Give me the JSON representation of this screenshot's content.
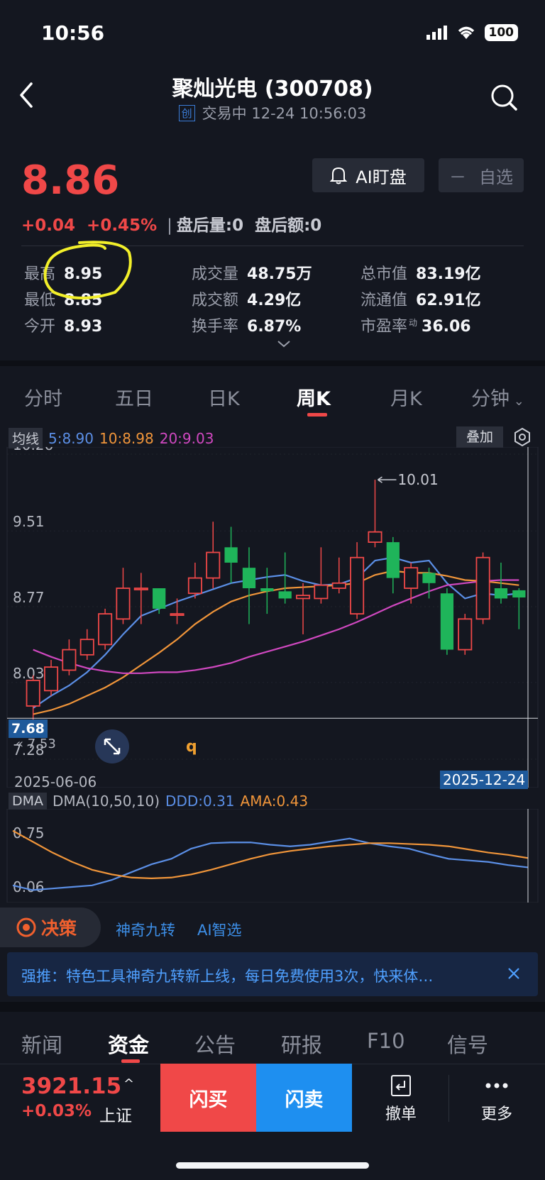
{
  "status_bar": {
    "time": "10:56",
    "battery": "100"
  },
  "header": {
    "title": "聚灿光电 (300708)",
    "board_tag": "创",
    "trade_status": "交易中",
    "timestamp": "12-24 10:56:03"
  },
  "quote": {
    "price": "8.86",
    "change": "+0.04",
    "change_pct": "+0.45%",
    "after_hours_volume": "盘后量:0",
    "after_hours_amount": "盘后额:0",
    "ai_button": "AI盯盘",
    "watch_button": "自选",
    "stats": [
      {
        "label": "最高",
        "value": "8.95",
        "color": "red"
      },
      {
        "label": "成交量",
        "value": "48.75万",
        "color": "white"
      },
      {
        "label": "总市值",
        "value": "83.19亿",
        "color": "white"
      },
      {
        "label": "最低",
        "value": "8.85",
        "color": "green"
      },
      {
        "label": "成交额",
        "value": "4.29亿",
        "color": "white"
      },
      {
        "label": "流通值",
        "value": "62.91亿",
        "color": "white"
      },
      {
        "label": "今开",
        "value": "8.93",
        "color": "red"
      },
      {
        "label": "换手率",
        "value": "6.87%",
        "color": "white"
      },
      {
        "label": "市盈率",
        "value": "36.06",
        "color": "white",
        "sup": "动"
      }
    ]
  },
  "period_tabs": [
    "分时",
    "五日",
    "日K",
    "周K",
    "月K",
    "分钟"
  ],
  "active_period": "周K",
  "ma_legend": {
    "label": "均线",
    "ma5": "5:8.90",
    "ma10": "10:8.98",
    "ma20": "20:9.03",
    "overlay_button": "叠加"
  },
  "chart_labels": {
    "max_marker": "10.01",
    "current_price": "7.68",
    "low_marker": "7.53",
    "q_mark": "q",
    "date_start": "2025-06-06",
    "date_end": "2025-12-24"
  },
  "dma_legend": {
    "label": "DMA",
    "params": "DMA(10,50,10)",
    "ddd": "DDD:0.31",
    "ama": "AMA:0.43"
  },
  "chart_data": [
    {
      "type": "candlestick",
      "title": "",
      "y_ticks": [
        "10.26",
        "9.51",
        "8.77",
        "8.03",
        "7.28"
      ],
      "ylim": [
        7.28,
        10.26
      ],
      "x_range": [
        "2025-06-06",
        "2025-12-24"
      ],
      "candles": [
        {
          "o": 7.8,
          "c": 8.05,
          "h": 8.1,
          "l": 7.53
        },
        {
          "o": 7.95,
          "c": 8.18,
          "h": 8.25,
          "l": 7.9
        },
        {
          "o": 8.15,
          "c": 8.35,
          "h": 8.45,
          "l": 8.1
        },
        {
          "o": 8.3,
          "c": 8.45,
          "h": 8.55,
          "l": 8.25
        },
        {
          "o": 8.4,
          "c": 8.7,
          "h": 8.75,
          "l": 8.35
        },
        {
          "o": 8.65,
          "c": 8.95,
          "h": 9.15,
          "l": 8.6
        },
        {
          "o": 8.95,
          "c": 8.95,
          "h": 9.1,
          "l": 8.6
        },
        {
          "o": 8.95,
          "c": 8.75,
          "h": 8.95,
          "l": 8.7
        },
        {
          "o": 8.7,
          "c": 8.7,
          "h": 8.85,
          "l": 8.6
        },
        {
          "o": 8.9,
          "c": 9.05,
          "h": 9.2,
          "l": 8.85
        },
        {
          "o": 9.05,
          "c": 9.3,
          "h": 9.6,
          "l": 8.95
        },
        {
          "o": 9.35,
          "c": 9.2,
          "h": 9.55,
          "l": 9.0
        },
        {
          "o": 9.15,
          "c": 8.95,
          "h": 9.35,
          "l": 8.6
        },
        {
          "o": 8.95,
          "c": 8.92,
          "h": 9.15,
          "l": 8.7
        },
        {
          "o": 8.92,
          "c": 8.85,
          "h": 9.3,
          "l": 8.8
        },
        {
          "o": 8.85,
          "c": 8.88,
          "h": 9.0,
          "l": 8.5
        },
        {
          "o": 8.85,
          "c": 8.98,
          "h": 9.35,
          "l": 8.8
        },
        {
          "o": 8.95,
          "c": 9.0,
          "h": 9.25,
          "l": 8.9
        },
        {
          "o": 8.7,
          "c": 9.25,
          "h": 9.4,
          "l": 8.65
        },
        {
          "o": 9.4,
          "c": 9.5,
          "h": 10.01,
          "l": 9.35
        },
        {
          "o": 9.4,
          "c": 9.05,
          "h": 9.45,
          "l": 8.9
        },
        {
          "o": 8.95,
          "c": 9.15,
          "h": 9.2,
          "l": 8.8
        },
        {
          "o": 9.1,
          "c": 9.0,
          "h": 9.15,
          "l": 8.85
        },
        {
          "o": 8.9,
          "c": 8.35,
          "h": 8.95,
          "l": 8.3
        },
        {
          "o": 8.35,
          "c": 8.65,
          "h": 8.7,
          "l": 8.3
        },
        {
          "o": 8.65,
          "c": 9.25,
          "h": 9.3,
          "l": 8.6
        },
        {
          "o": 8.95,
          "c": 8.85,
          "h": 9.2,
          "l": 8.8
        },
        {
          "o": 8.93,
          "c": 8.86,
          "h": 8.95,
          "l": 8.55
        }
      ],
      "series": [
        {
          "name": "5",
          "color": "#5b8fe6",
          "values": [
            7.78,
            7.9,
            8.0,
            8.13,
            8.3,
            8.5,
            8.68,
            8.75,
            8.82,
            8.88,
            8.94,
            9.0,
            9.03,
            9.06,
            9.08,
            9.02,
            8.98,
            8.99,
            9.05,
            9.22,
            9.25,
            9.2,
            9.22,
            9.0,
            8.85,
            8.9,
            8.88,
            8.9
          ]
        },
        {
          "name": "10",
          "color": "#f0953a",
          "values": [
            7.72,
            7.76,
            7.82,
            7.9,
            7.98,
            8.08,
            8.2,
            8.32,
            8.45,
            8.6,
            8.72,
            8.82,
            8.88,
            8.92,
            8.95,
            8.96,
            8.97,
            8.98,
            9.0,
            9.08,
            9.12,
            9.1,
            9.1,
            9.07,
            9.03,
            9.02,
            9.0,
            8.98
          ]
        },
        {
          "name": "20",
          "color": "#d048c0",
          "values": [
            8.35,
            8.28,
            8.22,
            8.17,
            8.14,
            8.12,
            8.12,
            8.13,
            8.13,
            8.15,
            8.18,
            8.22,
            8.28,
            8.33,
            8.38,
            8.43,
            8.49,
            8.55,
            8.62,
            8.7,
            8.78,
            8.85,
            8.92,
            8.98,
            9.0,
            9.02,
            9.03,
            9.03
          ]
        }
      ]
    },
    {
      "type": "line",
      "title": "DMA",
      "y_ticks": [
        "0.75",
        "0.06"
      ],
      "series": [
        {
          "name": "DDD",
          "color": "#5b8fe6",
          "values": [
            0.08,
            0.02,
            0.04,
            0.06,
            0.08,
            0.15,
            0.25,
            0.35,
            0.42,
            0.55,
            0.62,
            0.63,
            0.63,
            0.6,
            0.58,
            0.6,
            0.64,
            0.68,
            0.62,
            0.58,
            0.55,
            0.48,
            0.42,
            0.4,
            0.38,
            0.34,
            0.31
          ]
        },
        {
          "name": "AMA",
          "color": "#f0953a",
          "values": [
            0.78,
            0.64,
            0.5,
            0.38,
            0.28,
            0.22,
            0.18,
            0.17,
            0.18,
            0.22,
            0.28,
            0.35,
            0.42,
            0.48,
            0.52,
            0.55,
            0.58,
            0.6,
            0.62,
            0.62,
            0.61,
            0.6,
            0.58,
            0.54,
            0.5,
            0.47,
            0.43
          ]
        }
      ]
    }
  ],
  "decision": {
    "label": "决策",
    "tool1": "神奇九转",
    "tool2": "AI智选",
    "promo": "强推：特色工具神奇九转新上线，每日免费使用3次，快来体…"
  },
  "bottom_tabs": [
    "新闻",
    "资金",
    "公告",
    "研报",
    "F10",
    "信号"
  ],
  "active_bottom_tab": "资金",
  "trade_bar": {
    "index_value": "3921.15",
    "index_change": "+0.03%",
    "index_name": "上证",
    "buy": "闪买",
    "sell": "闪卖",
    "cancel": "撤单",
    "more": "更多"
  }
}
